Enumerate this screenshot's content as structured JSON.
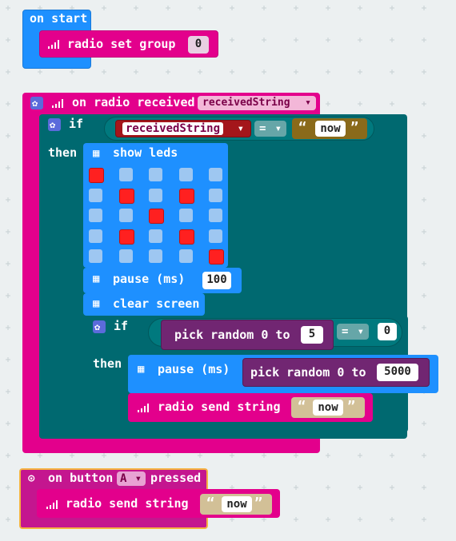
{
  "workspace": {
    "background": "#ecf0f1"
  },
  "colors": {
    "basic": "#1e90ff",
    "radio": "#e3008c",
    "logic": "#006970",
    "math": "#712672",
    "text": "#b8a06a",
    "input": "#c4168f"
  },
  "on_start": {
    "label": "on start",
    "radio_set_group": {
      "label": "radio set group",
      "value": "0"
    }
  },
  "on_radio_received": {
    "label": "on radio received",
    "variable": "receivedString",
    "if_label": "if",
    "then_label": "then",
    "condition": {
      "variable": "receivedString",
      "operator": "=",
      "value": "now"
    },
    "show_leds": {
      "label": "show leds",
      "grid": [
        [
          1,
          0,
          0,
          0,
          0
        ],
        [
          0,
          1,
          0,
          1,
          0
        ],
        [
          0,
          0,
          1,
          0,
          0
        ],
        [
          0,
          1,
          0,
          1,
          0
        ],
        [
          0,
          0,
          0,
          0,
          1
        ]
      ]
    },
    "pause": {
      "label": "pause (ms)",
      "value": "100"
    },
    "clear_screen": {
      "label": "clear screen"
    },
    "inner_if": {
      "if_label": "if",
      "then_label": "then",
      "pick_random_label": "pick random 0 to",
      "pick_random_value": "5",
      "operator": "=",
      "compare_value": "0",
      "pause_label": "pause (ms)",
      "pause_random_label": "pick random 0 to",
      "pause_random_value": "5000",
      "send_label": "radio send string",
      "send_value": "now"
    }
  },
  "on_button": {
    "label_prefix": "on button",
    "button": "A",
    "label_suffix": "pressed",
    "send_label": "radio send string",
    "send_value": "now"
  },
  "glyphs": {
    "quote_open": "“",
    "quote_close": "”",
    "dropdown_arrow": "▾"
  }
}
